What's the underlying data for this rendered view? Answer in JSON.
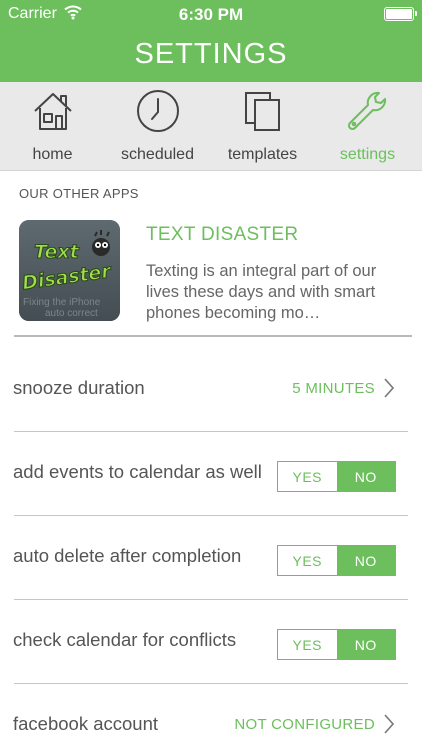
{
  "status_bar": {
    "carrier": "Carrier",
    "time": "6:30 PM"
  },
  "nav": {
    "title": "SETTINGS"
  },
  "tabs": [
    {
      "label": "home",
      "icon": "house-icon",
      "active": false
    },
    {
      "label": "scheduled",
      "icon": "clock-icon",
      "active": false
    },
    {
      "label": "templates",
      "icon": "documents-icon",
      "active": false
    },
    {
      "label": "settings",
      "icon": "wrench-icon",
      "active": true
    }
  ],
  "other_apps": {
    "header": "OUR OTHER APPS",
    "app": {
      "name": "TEXT DISASTER",
      "icon_text_line1": "Text",
      "icon_text_line2": "Disaster",
      "icon_watermark_line1": "Fixing the iPhone",
      "icon_watermark_line2": "auto correct",
      "description": "Texting is an integral part of our lives these days and with smart phones becoming mo…"
    }
  },
  "settings": {
    "snooze": {
      "label": "snooze duration",
      "value": "5 MINUTES"
    },
    "calendar_events": {
      "label": "add events to calendar as well",
      "yes": "YES",
      "no": "NO",
      "selected": "no"
    },
    "auto_delete": {
      "label": "auto delete after completion",
      "yes": "YES",
      "no": "NO",
      "selected": "no"
    },
    "check_conflicts": {
      "label": "check calendar for conflicts",
      "yes": "YES",
      "no": "NO",
      "selected": "no"
    },
    "facebook": {
      "label": "facebook account",
      "value": "NOT CONFIGURED"
    }
  },
  "colors": {
    "accent": "#6cbf5c",
    "tab_bar": "#e9e9e9",
    "text": "#555555"
  }
}
